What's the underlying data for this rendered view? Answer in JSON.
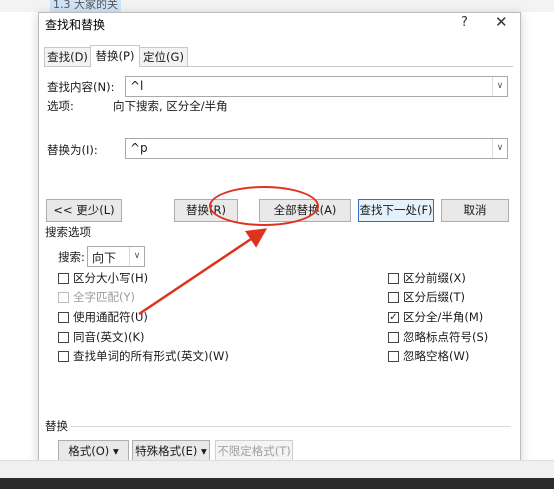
{
  "document": {
    "partial_text": "1.3 大家的关"
  },
  "dialog": {
    "title": "查找和替换",
    "help": "?",
    "close": "✕"
  },
  "tabs": [
    {
      "label": "查找(D)",
      "active": false
    },
    {
      "label": "替换(P)",
      "active": true
    },
    {
      "label": "定位(G)",
      "active": false
    }
  ],
  "find": {
    "label": "查找内容(N):",
    "value": "^l"
  },
  "options_line": {
    "label": "选项:",
    "value": "向下搜索, 区分全/半角"
  },
  "replace": {
    "label": "替换为(I):",
    "value": "^p"
  },
  "buttons": {
    "less": "<< 更少(L)",
    "replace": "替换(R)",
    "replace_all": "全部替换(A)",
    "find_next": "查找下一处(F)",
    "cancel": "取消"
  },
  "search_options": {
    "title": "搜索选项",
    "search_label": "搜索:",
    "search_value": "向下",
    "left": [
      {
        "label": "区分大小写(H)",
        "checked": false,
        "disabled": false
      },
      {
        "label": "全字匹配(Y)",
        "checked": false,
        "disabled": true
      },
      {
        "label": "使用通配符(U)",
        "checked": false,
        "disabled": false
      },
      {
        "label": "同音(英文)(K)",
        "checked": false,
        "disabled": false
      },
      {
        "label": "查找单词的所有形式(英文)(W)",
        "checked": false,
        "disabled": false
      }
    ],
    "right": [
      {
        "label": "区分前缀(X)",
        "checked": false,
        "disabled": false
      },
      {
        "label": "区分后缀(T)",
        "checked": false,
        "disabled": false
      },
      {
        "label": "区分全/半角(M)",
        "checked": true,
        "disabled": false
      },
      {
        "label": "忽略标点符号(S)",
        "checked": false,
        "disabled": false
      },
      {
        "label": "忽略空格(W)",
        "checked": false,
        "disabled": false
      }
    ]
  },
  "replace_section": {
    "title": "替换",
    "format": "格式(O) ▾",
    "special": "特殊格式(E) ▾",
    "no_format": "不限定格式(T)"
  },
  "colors": {
    "annotation": "#e0301e",
    "primary_border": "#2f6fc3"
  }
}
